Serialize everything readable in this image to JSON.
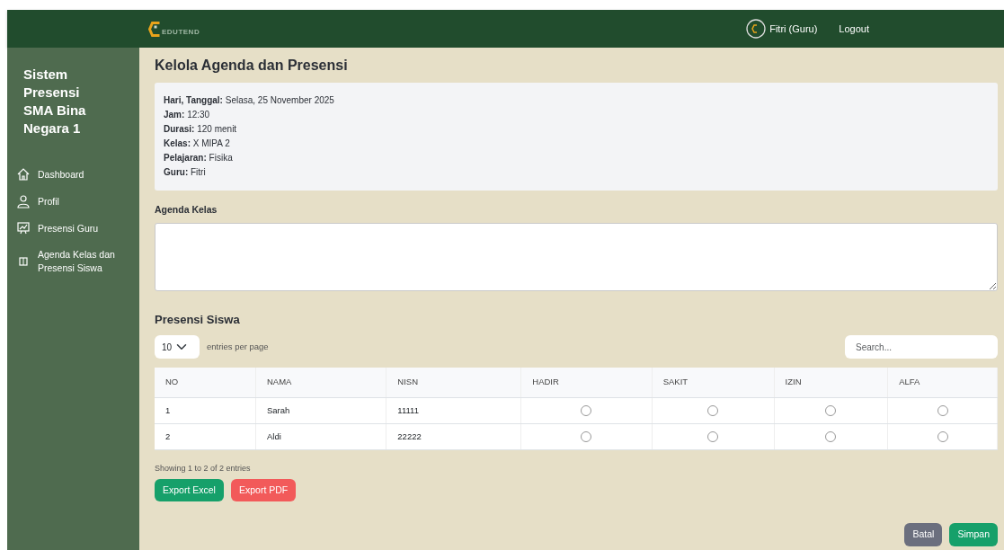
{
  "navbar": {
    "brand": "EDUTEND",
    "user": "Fitri (Guru)",
    "logout": "Logout"
  },
  "sidebar": {
    "title": "Sistem Presensi SMA Bina Negara 1",
    "items": [
      {
        "label": "Dashboard"
      },
      {
        "label": "Profil"
      },
      {
        "label": "Presensi Guru"
      },
      {
        "label": "Agenda Kelas dan Presensi Siswa"
      }
    ]
  },
  "page_title": "Kelola Agenda dan Presensi",
  "info": [
    {
      "label": "Hari, Tanggal:",
      "value": "Selasa, 25 November 2025"
    },
    {
      "label": "Jam:",
      "value": "12:30"
    },
    {
      "label": "Durasi:",
      "value": "120 menit"
    },
    {
      "label": "Kelas:",
      "value": "X MIPA 2"
    },
    {
      "label": "Pelajaran:",
      "value": "Fisika"
    },
    {
      "label": "Guru:",
      "value": "Fitri"
    }
  ],
  "agenda": {
    "label": "Agenda Kelas"
  },
  "presensi": {
    "title": "Presensi Siswa",
    "page_size": "10",
    "page_size_label": "entries per page",
    "search_placeholder": "Search...",
    "columns": [
      "NO",
      "NAMA",
      "NISN",
      "HADIR",
      "SAKIT",
      "IZIN",
      "ALFA"
    ],
    "rows": [
      {
        "no": "1",
        "nama": "Sarah",
        "nisn": "11111",
        "choices": [
          {
            "selected": false
          },
          {
            "selected": false
          },
          {
            "selected": false
          },
          {
            "selected": false
          }
        ]
      },
      {
        "no": "2",
        "nama": "Aldi",
        "nisn": "22222",
        "choices": [
          {
            "selected": false
          },
          {
            "selected": false
          },
          {
            "selected": false
          },
          {
            "selected": false
          }
        ]
      }
    ],
    "info": "Showing 1 to 2 of 2 entries",
    "export_buttons": [
      {
        "label": "Export Excel",
        "kind": "excel"
      },
      {
        "label": "Export PDF",
        "kind": "pdf"
      }
    ]
  },
  "actions": [
    {
      "label": "Batal",
      "kind": "cancel"
    },
    {
      "label": "Simpan",
      "kind": "save"
    }
  ]
}
